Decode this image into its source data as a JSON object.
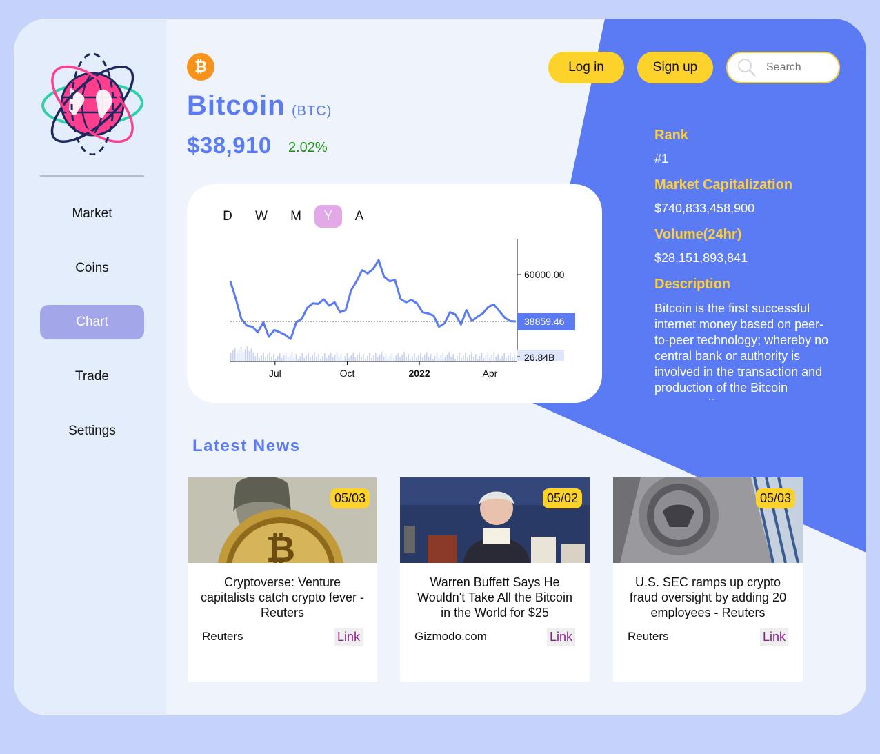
{
  "sidebar": {
    "items": [
      {
        "label": "Market"
      },
      {
        "label": "Coins"
      },
      {
        "label": "Chart",
        "active": true
      },
      {
        "label": "Trade"
      },
      {
        "label": "Settings"
      }
    ]
  },
  "header": {
    "login_label": "Log in",
    "signup_label": "Sign up",
    "search_placeholder": "Search"
  },
  "coin": {
    "icon_symbol": "₿",
    "name": "Bitcoin",
    "symbol": "(BTC)",
    "price": "$38,910",
    "change": "2.02%",
    "change_color": "#17930f"
  },
  "stats": {
    "rank_label": "Rank",
    "rank": "#1",
    "market_cap_label": "Market Capitalization",
    "market_cap": "$740,833,458,900",
    "volume_label": "Volume(24hr)",
    "volume": "$28,151,893,841",
    "description_label": "Description",
    "description": "Bitcoin is the first successful internet money based on peer-to-peer technology; whereby no central bank or authority is involved in the transaction and production of the Bitcoin currency. It"
  },
  "chart_controls": {
    "ranges": [
      "D",
      "W",
      "M",
      "Y",
      "A"
    ],
    "active": "Y"
  },
  "chart_data": {
    "type": "line",
    "x_ticks": [
      "Jul",
      "Oct",
      "2022",
      "Apr"
    ],
    "y_tick": "60000.00",
    "last_price_label": "38859.46",
    "volume_label": "26.84B",
    "x": [
      "2021-05-05",
      "2021-05-12",
      "2021-05-19",
      "2021-05-26",
      "2021-06-02",
      "2021-06-09",
      "2021-06-16",
      "2021-06-23",
      "2021-06-30",
      "2021-07-07",
      "2021-07-14",
      "2021-07-21",
      "2021-07-28",
      "2021-08-04",
      "2021-08-11",
      "2021-08-18",
      "2021-08-25",
      "2021-09-01",
      "2021-09-08",
      "2021-09-15",
      "2021-09-22",
      "2021-09-29",
      "2021-10-06",
      "2021-10-13",
      "2021-10-20",
      "2021-10-27",
      "2021-11-03",
      "2021-11-10",
      "2021-11-17",
      "2021-11-24",
      "2021-12-01",
      "2021-12-08",
      "2021-12-15",
      "2021-12-22",
      "2021-12-29",
      "2022-01-05",
      "2022-01-12",
      "2022-01-19",
      "2022-01-26",
      "2022-02-02",
      "2022-02-09",
      "2022-02-16",
      "2022-02-23",
      "2022-03-02",
      "2022-03-09",
      "2022-03-16",
      "2022-03-23",
      "2022-03-30",
      "2022-04-06",
      "2022-04-13",
      "2022-04-20",
      "2022-04-27",
      "2022-05-04"
    ],
    "values": [
      57000,
      49000,
      40000,
      37000,
      36500,
      34000,
      38500,
      32000,
      35000,
      34000,
      32800,
      31000,
      38500,
      40000,
      45000,
      47000,
      46800,
      48800,
      46000,
      47500,
      43000,
      44000,
      53000,
      57000,
      62000,
      60500,
      62500,
      66500,
      59000,
      57000,
      57500,
      49000,
      47500,
      48600,
      47000,
      43000,
      42500,
      41500,
      36500,
      38000,
      43000,
      42000,
      37500,
      44000,
      39000,
      41000,
      42500,
      45500,
      46500,
      43500,
      40500,
      39000,
      38859.46
    ],
    "ylabel": "",
    "volume_series": "bars"
  },
  "news": {
    "title": "Latest News",
    "items": [
      {
        "date": "05/03",
        "headline": "Cryptoverse: Venture capitalists catch crypto fever - Reuters",
        "source": "Reuters",
        "link_label": "Link"
      },
      {
        "date": "05/02",
        "headline": "Warren Buffett Says He Wouldn't Take All the Bitcoin in the World for $25",
        "source": "Gizmodo.com",
        "link_label": "Link"
      },
      {
        "date": "05/03",
        "headline": "U.S. SEC ramps up crypto fraud oversight by adding 20 employees - Reuters",
        "source": "Reuters",
        "link_label": "Link"
      }
    ]
  },
  "colors": {
    "accent": "#5b7bf5",
    "highlight": "#fcd22b",
    "sidebar_active": "#a3a6e8",
    "range_active": "#e3a8e8"
  }
}
